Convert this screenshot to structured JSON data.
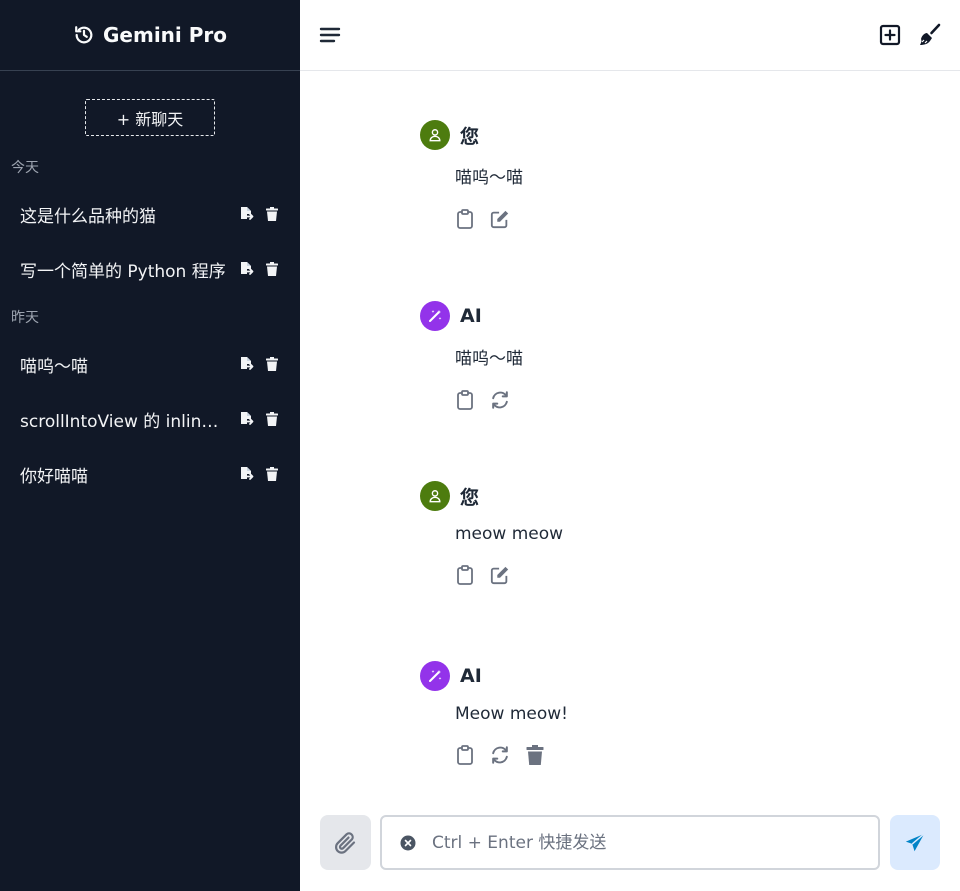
{
  "app": {
    "title": "Gemini Pro"
  },
  "sidebar": {
    "new_chat_label": "+ 新聊天",
    "groups": [
      {
        "label": "今天",
        "items": [
          {
            "label": "这是什么品种的猫"
          },
          {
            "label": "写一个简单的 Python 程序"
          }
        ]
      },
      {
        "label": "昨天",
        "items": [
          {
            "label": "喵呜～喵"
          },
          {
            "label": "scrollIntoView 的 inline 和 block"
          },
          {
            "label": "你好喵喵"
          }
        ]
      }
    ]
  },
  "messages": [
    {
      "role": "您",
      "type": "user",
      "text": "喵呜～喵"
    },
    {
      "role": "AI",
      "type": "ai",
      "text": "喵呜～喵"
    },
    {
      "role": "您",
      "type": "user",
      "text": "meow meow"
    },
    {
      "role": "AI",
      "type": "ai",
      "text": "Meow meow!"
    }
  ],
  "input": {
    "placeholder": "Ctrl + Enter 快捷发送",
    "value": ""
  },
  "colors": {
    "sidebar_bg": "#111827",
    "user_avatar": "#4d7c0f",
    "ai_avatar": "#9333ea",
    "send_icon": "#0284c7"
  }
}
